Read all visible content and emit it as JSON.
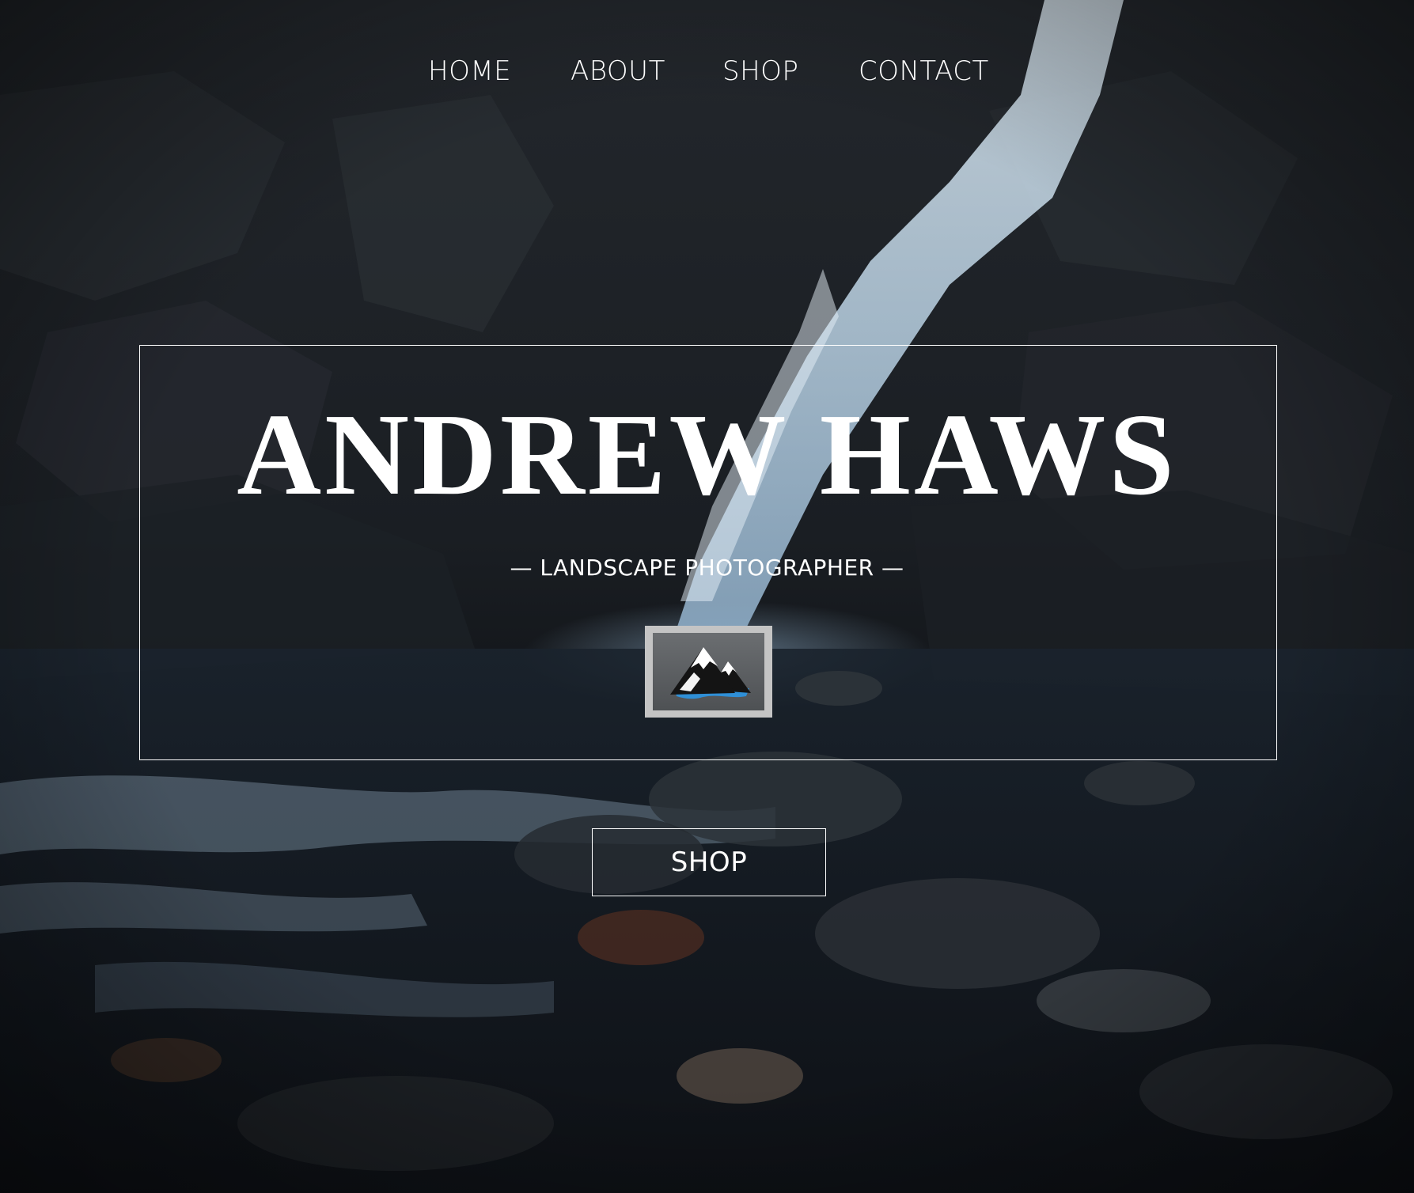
{
  "nav": {
    "items": [
      {
        "label": "HOME"
      },
      {
        "label": "ABOUT"
      },
      {
        "label": "SHOP"
      },
      {
        "label": "CONTACT"
      }
    ]
  },
  "hero": {
    "title": "ANDREW HAWS",
    "subtitle": "— LANDSCAPE PHOTOGRAPHER —",
    "logo_icon": "mountain-logo-icon",
    "background_image": "waterfall-photo"
  },
  "cta": {
    "shop_label": "SHOP"
  },
  "colors": {
    "text": "#ffffff",
    "logo_frame": "#c4c4c4",
    "logo_water": "#2f8fd6"
  }
}
